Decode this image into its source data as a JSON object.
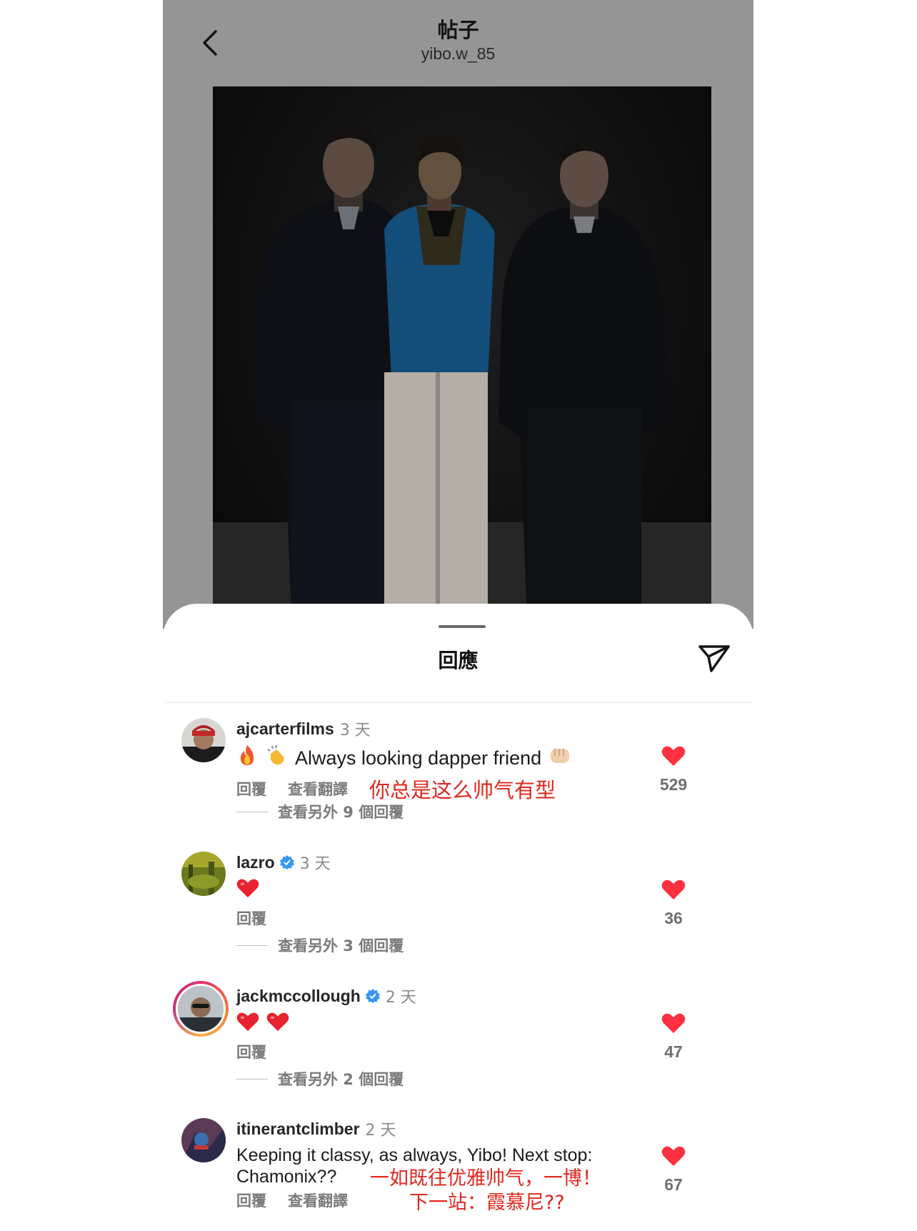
{
  "header": {
    "title": "帖子",
    "subtitle": "yibo.w_85"
  },
  "sheet": {
    "title": "回應"
  },
  "colors": {
    "overlay": "#959595",
    "like_red": "#ff3040",
    "annotation_red": "#e0271e",
    "verified_blue": "#3897f0"
  },
  "comments": [
    {
      "username": "ajcarterfilms",
      "verified": false,
      "time": "3 天",
      "text": "Always looking dapper friend",
      "emojis": [
        "fire-emoji",
        "clap-emoji"
      ],
      "trailing_emoji": "fist-emoji",
      "actions": [
        "回覆",
        "查看翻譯"
      ],
      "annotation": "你总是这么帅气有型",
      "replies": "查看另外 9 個回覆",
      "likes": "529"
    },
    {
      "username": "lazro",
      "verified": true,
      "time": "3 天",
      "emojis": [
        "heart-emoji"
      ],
      "actions": [
        "回覆"
      ],
      "replies": "查看另外 3 個回覆",
      "likes": "36"
    },
    {
      "username": "jackmccollough",
      "verified": true,
      "time": "2 天",
      "emojis": [
        "heart-emoji",
        "heart-emoji"
      ],
      "actions": [
        "回覆"
      ],
      "replies": "查看另外 2 個回覆",
      "likes": "47"
    },
    {
      "username": "itinerantclimber",
      "verified": false,
      "time": "2 天",
      "text_line1": "Keeping it classy, as always, Yibo! Next stop:",
      "text_line2": "Chamonix??",
      "actions": [
        "回覆",
        "查看翻譯"
      ],
      "annotation_line1": "一如既往优雅帅气，一博！",
      "annotation_line2": "下一站：霞慕尼??",
      "likes": "67"
    }
  ]
}
